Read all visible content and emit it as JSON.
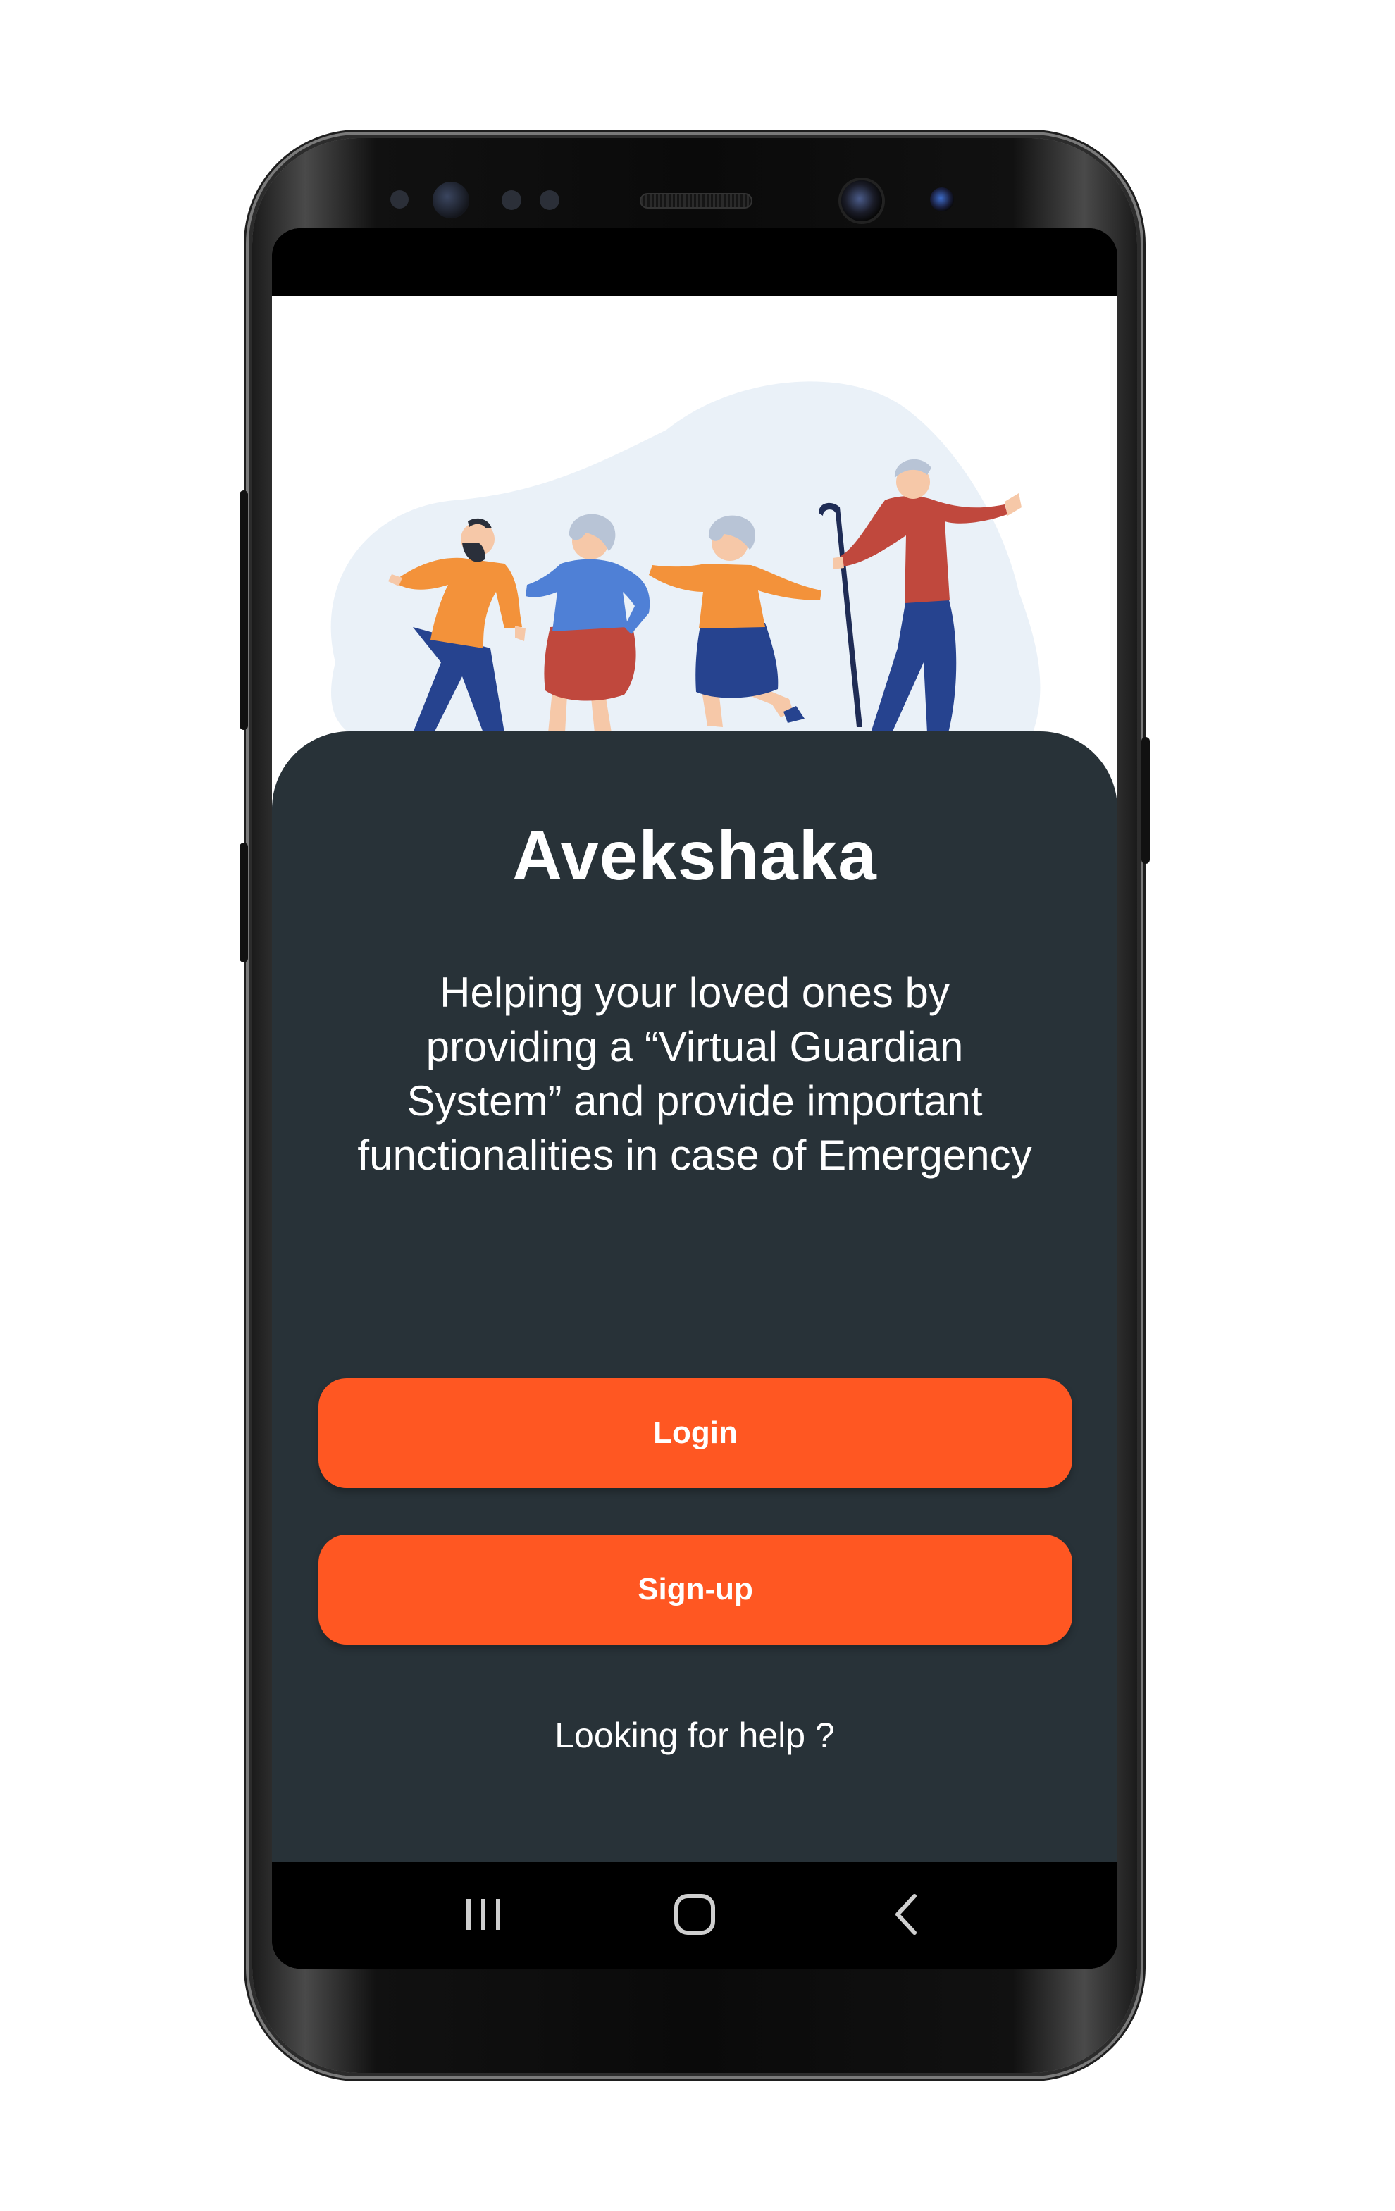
{
  "app": {
    "title": "Avekshaka",
    "tagline": "Helping your loved ones by providing a “Virtual Guardian System”  and provide important functionalities in case of Emergency"
  },
  "actions": {
    "login_label": "Login",
    "signup_label": "Sign-up",
    "help_label": "Looking for help ?"
  },
  "navigation": {
    "recent_icon": "recent-apps-icon",
    "home_icon": "home-icon",
    "back_icon": "back-icon"
  },
  "colors": {
    "accent": "#ff5722",
    "card_background": "#283238",
    "text_on_dark": "#ffffff"
  }
}
